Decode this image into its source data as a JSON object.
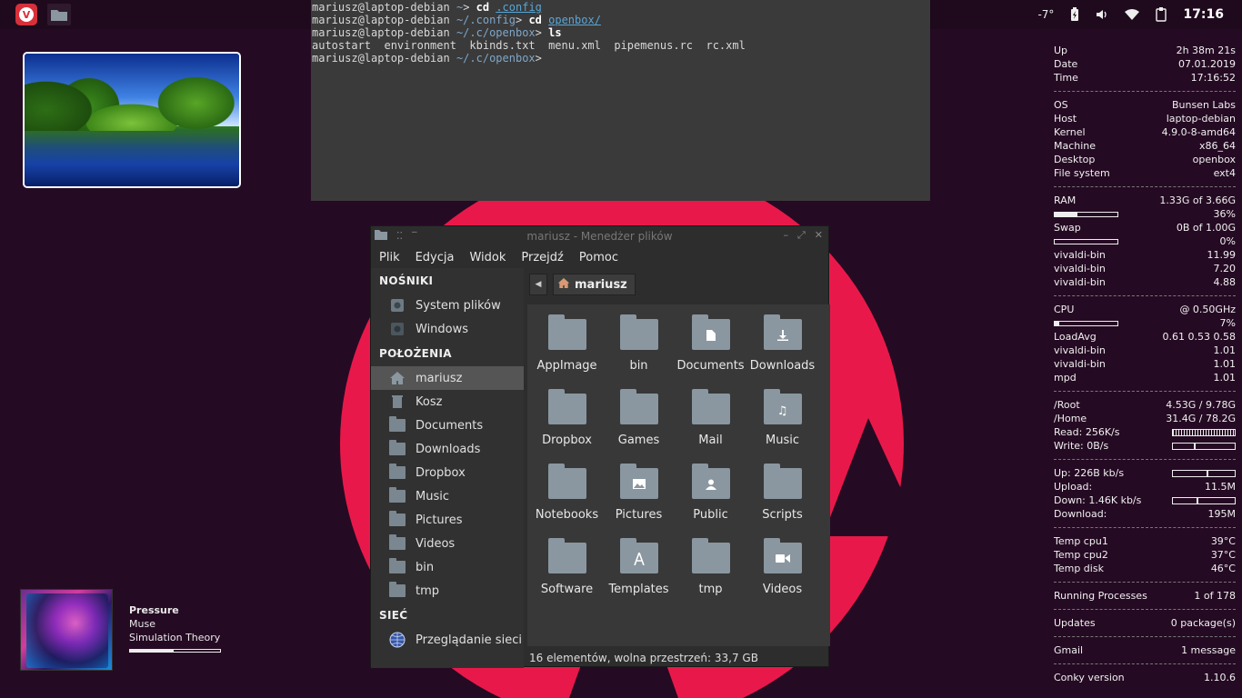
{
  "panel": {
    "temperature": "-7°",
    "clock": "17:16"
  },
  "terminal": {
    "lines": [
      {
        "prompt": "mariusz@laptop-debian ",
        "path": "~",
        "sep": "> ",
        "cmd": "cd ",
        "arg": ".config"
      },
      {
        "prompt": "mariusz@laptop-debian ",
        "path": "~/.config",
        "sep": "> ",
        "cmd": "cd ",
        "arg": "openbox/"
      },
      {
        "prompt": "mariusz@laptop-debian ",
        "path": "~/.c/openbox",
        "sep": "> ",
        "cmd": "ls",
        "arg": ""
      },
      {
        "output": "autostart  environment  kbinds.txt  menu.xml  pipemenus.rc  rc.xml"
      },
      {
        "prompt": "mariusz@laptop-debian ",
        "path": "~/.c/openbox",
        "sep": ">",
        "cmd": "",
        "arg": ""
      }
    ]
  },
  "file_manager": {
    "title": "mariusz - Menedżer plików",
    "menu": [
      "Plik",
      "Edycja",
      "Widok",
      "Przejdź",
      "Pomoc"
    ],
    "sidebar": {
      "devices_header": "NOŚNIKI",
      "devices": [
        "System plików",
        "Windows"
      ],
      "places_header": "POŁOŻENIA",
      "places": [
        "mariusz",
        "Kosz",
        "Documents",
        "Downloads",
        "Dropbox",
        "Music",
        "Pictures",
        "Videos",
        "bin",
        "tmp"
      ],
      "network_header": "SIEĆ",
      "network": [
        "Przeglądanie sieci"
      ]
    },
    "breadcrumb": "mariusz",
    "files": [
      {
        "name": "AppImage",
        "emblem": ""
      },
      {
        "name": "bin",
        "emblem": ""
      },
      {
        "name": "Documents",
        "emblem": "document"
      },
      {
        "name": "Downloads",
        "emblem": "download"
      },
      {
        "name": "Dropbox",
        "emblem": ""
      },
      {
        "name": "Games",
        "emblem": ""
      },
      {
        "name": "Mail",
        "emblem": ""
      },
      {
        "name": "Music",
        "emblem": "music"
      },
      {
        "name": "Notebooks",
        "emblem": ""
      },
      {
        "name": "Pictures",
        "emblem": "image"
      },
      {
        "name": "Public",
        "emblem": "person"
      },
      {
        "name": "Scripts",
        "emblem": ""
      },
      {
        "name": "Software",
        "emblem": ""
      },
      {
        "name": "Templates",
        "emblem": "template"
      },
      {
        "name": "tmp",
        "emblem": ""
      },
      {
        "name": "Videos",
        "emblem": "video"
      }
    ],
    "status": "16 elementów, wolna przestrzeń: 33,7 GB"
  },
  "music": {
    "title": "Pressure",
    "artist": "Muse",
    "album": "Simulation Theory",
    "progress": 0.48
  },
  "conky": {
    "rows": [
      {
        "type": "kv",
        "k": "Up",
        "v": "2h 38m 21s"
      },
      {
        "type": "kv",
        "k": "Date",
        "v": "07.01.2019"
      },
      {
        "type": "kv",
        "k": "Time",
        "v": "17:16:52"
      },
      {
        "type": "sep"
      },
      {
        "type": "kv",
        "k": "OS",
        "v": "Bunsen Labs"
      },
      {
        "type": "kv",
        "k": "Host",
        "v": "laptop-debian"
      },
      {
        "type": "kv",
        "k": "Kernel",
        "v": "4.9.0-8-amd64"
      },
      {
        "type": "kv",
        "k": "Machine",
        "v": "x86_64"
      },
      {
        "type": "kv",
        "k": "Desktop",
        "v": "openbox"
      },
      {
        "type": "kv",
        "k": "File system",
        "v": "ext4"
      },
      {
        "type": "sep"
      },
      {
        "type": "kv",
        "k": "RAM",
        "v": "1.33G of 3.66G"
      },
      {
        "type": "bar",
        "fill": 0.36,
        "v": "36%"
      },
      {
        "type": "kv",
        "k": "Swap",
        "v": "0B of 1.00G"
      },
      {
        "type": "bar",
        "fill": 0.0,
        "v": "0%"
      },
      {
        "type": "kv",
        "k": "vivaldi-bin",
        "v": "11.99"
      },
      {
        "type": "kv",
        "k": "vivaldi-bin",
        "v": "7.20"
      },
      {
        "type": "kv",
        "k": "vivaldi-bin",
        "v": "4.88"
      },
      {
        "type": "sep"
      },
      {
        "type": "kv",
        "k": "CPU",
        "v": "@ 0.50GHz"
      },
      {
        "type": "bar",
        "fill": 0.07,
        "v": "7%"
      },
      {
        "type": "kv",
        "k": "LoadAvg",
        "v": "0.61 0.53 0.58"
      },
      {
        "type": "kv",
        "k": "vivaldi-bin",
        "v": "1.01"
      },
      {
        "type": "kv",
        "k": "vivaldi-bin",
        "v": "1.01"
      },
      {
        "type": "kv",
        "k": "mpd",
        "v": "1.01"
      },
      {
        "type": "sep"
      },
      {
        "type": "kv",
        "k": "/Root",
        "v": "4.53G / 9.78G"
      },
      {
        "type": "kv",
        "k": "/Home",
        "v": "31.4G / 78.2G"
      },
      {
        "type": "graph",
        "k": "Read: 256K/s",
        "style": "dense"
      },
      {
        "type": "graph",
        "k": "Write: 0B/s",
        "style": "spike"
      },
      {
        "type": "sep"
      },
      {
        "type": "graph",
        "k": "Up: 226B kb/s",
        "style": "spike"
      },
      {
        "type": "kv",
        "k": "Upload:",
        "v": "11.5M"
      },
      {
        "type": "graph",
        "k": "Down: 1.46K kb/s",
        "style": "spike"
      },
      {
        "type": "kv",
        "k": "Download:",
        "v": "195M"
      },
      {
        "type": "sep"
      },
      {
        "type": "kv",
        "k": "Temp cpu1",
        "v": "39°C"
      },
      {
        "type": "kv",
        "k": "Temp cpu2",
        "v": "37°C"
      },
      {
        "type": "kv",
        "k": "Temp disk",
        "v": "46°C"
      },
      {
        "type": "sep"
      },
      {
        "type": "kv",
        "k": "Running Processes",
        "v": "1 of 178"
      },
      {
        "type": "sep"
      },
      {
        "type": "kv",
        "k": "Updates",
        "v": "0 package(s)"
      },
      {
        "type": "sep"
      },
      {
        "type": "kv",
        "k": "Gmail",
        "v": "1 message"
      },
      {
        "type": "sep"
      },
      {
        "type": "kv",
        "k": "Conky version",
        "v": "1.10.6"
      }
    ]
  }
}
